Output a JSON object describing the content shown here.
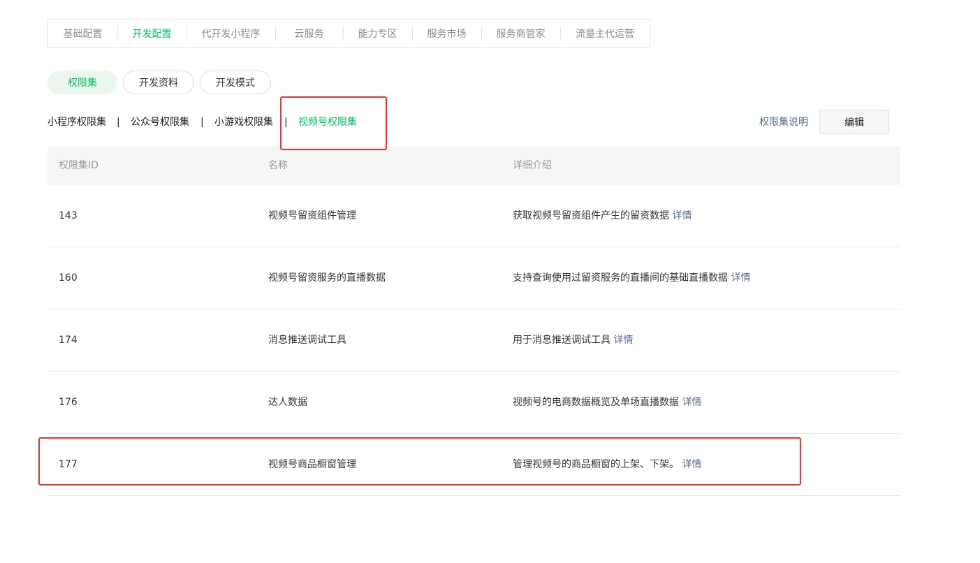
{
  "top_nav": {
    "tabs": [
      {
        "label": "基础配置"
      },
      {
        "label": "开发配置"
      },
      {
        "label": "代开发小程序"
      },
      {
        "label": "云服务"
      },
      {
        "label": "能力专区"
      },
      {
        "label": "服务市场"
      },
      {
        "label": "服务商管家"
      },
      {
        "label": "流量主代运营"
      }
    ],
    "active": "开发配置"
  },
  "section_tabs": [
    {
      "label": "权限集"
    },
    {
      "label": "开发资料"
    },
    {
      "label": "开发模式"
    }
  ],
  "sub_tabs": {
    "items": [
      {
        "label": "小程序权限集"
      },
      {
        "label": "公众号权限集"
      },
      {
        "label": "小游戏权限集"
      },
      {
        "label": "视频号权限集"
      }
    ],
    "separator": "|",
    "active": "视频号权限集"
  },
  "actions": {
    "help_label": "权限集说明",
    "edit_label": "编辑"
  },
  "table": {
    "headers": {
      "id": "权限集ID",
      "name": "名称",
      "desc": "详细介绍"
    },
    "detail_label": "详情",
    "rows": [
      {
        "id": "143",
        "name": "视频号留资组件管理",
        "desc": "获取视频号留资组件产生的留资数据"
      },
      {
        "id": "160",
        "name": "视频号留资服务的直播数据",
        "desc": "支持查询使用过留资服务的直播间的基础直播数据"
      },
      {
        "id": "174",
        "name": "消息推送调试工具",
        "desc": "用于消息推送调试工具"
      },
      {
        "id": "176",
        "name": "达人数据",
        "desc": "视频号的电商数据概览及单场直播数据"
      },
      {
        "id": "177",
        "name": "视频号商品橱窗管理",
        "desc": "管理视频号的商品橱窗的上架、下架。"
      }
    ]
  },
  "colors": {
    "accent": "#07c160",
    "link": "#576b95",
    "highlight": "#f0302d"
  }
}
